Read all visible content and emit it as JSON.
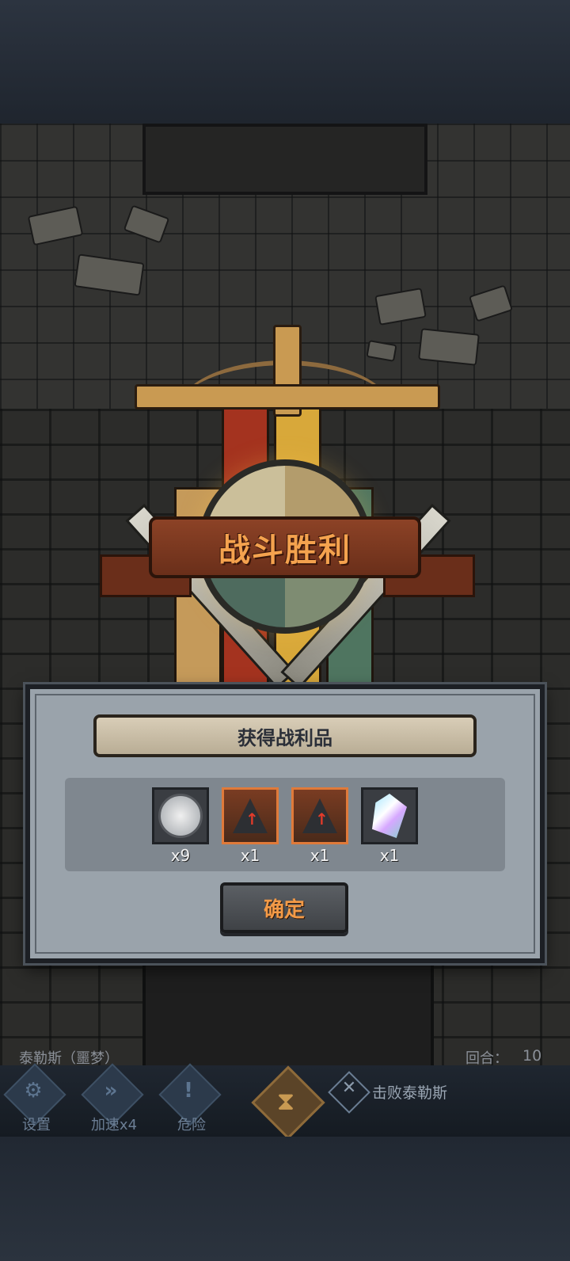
{
  "victory": {
    "title": "战斗胜利"
  },
  "rewards_panel": {
    "header": "获得战利品",
    "items": [
      {
        "icon": "silver-coin-icon",
        "count": "x9"
      },
      {
        "icon": "dark-shard-icon",
        "count": "x1"
      },
      {
        "icon": "dark-shard-icon",
        "count": "x1"
      },
      {
        "icon": "rainbow-crystal-icon",
        "count": "x1"
      }
    ],
    "confirm_label": "确定"
  },
  "status": {
    "boss_name": "泰勒斯（噩梦）",
    "round_label": "回合：",
    "round_value": "10"
  },
  "actions": {
    "settings_label": "设置",
    "speed_label": "加速x4",
    "danger_label": "危险",
    "objective_text": "击败泰勒斯"
  },
  "colors": {
    "title_orange": "#f4a24e",
    "rare_border": "#e07a3a",
    "panel_gray": "#9aa3ab"
  }
}
